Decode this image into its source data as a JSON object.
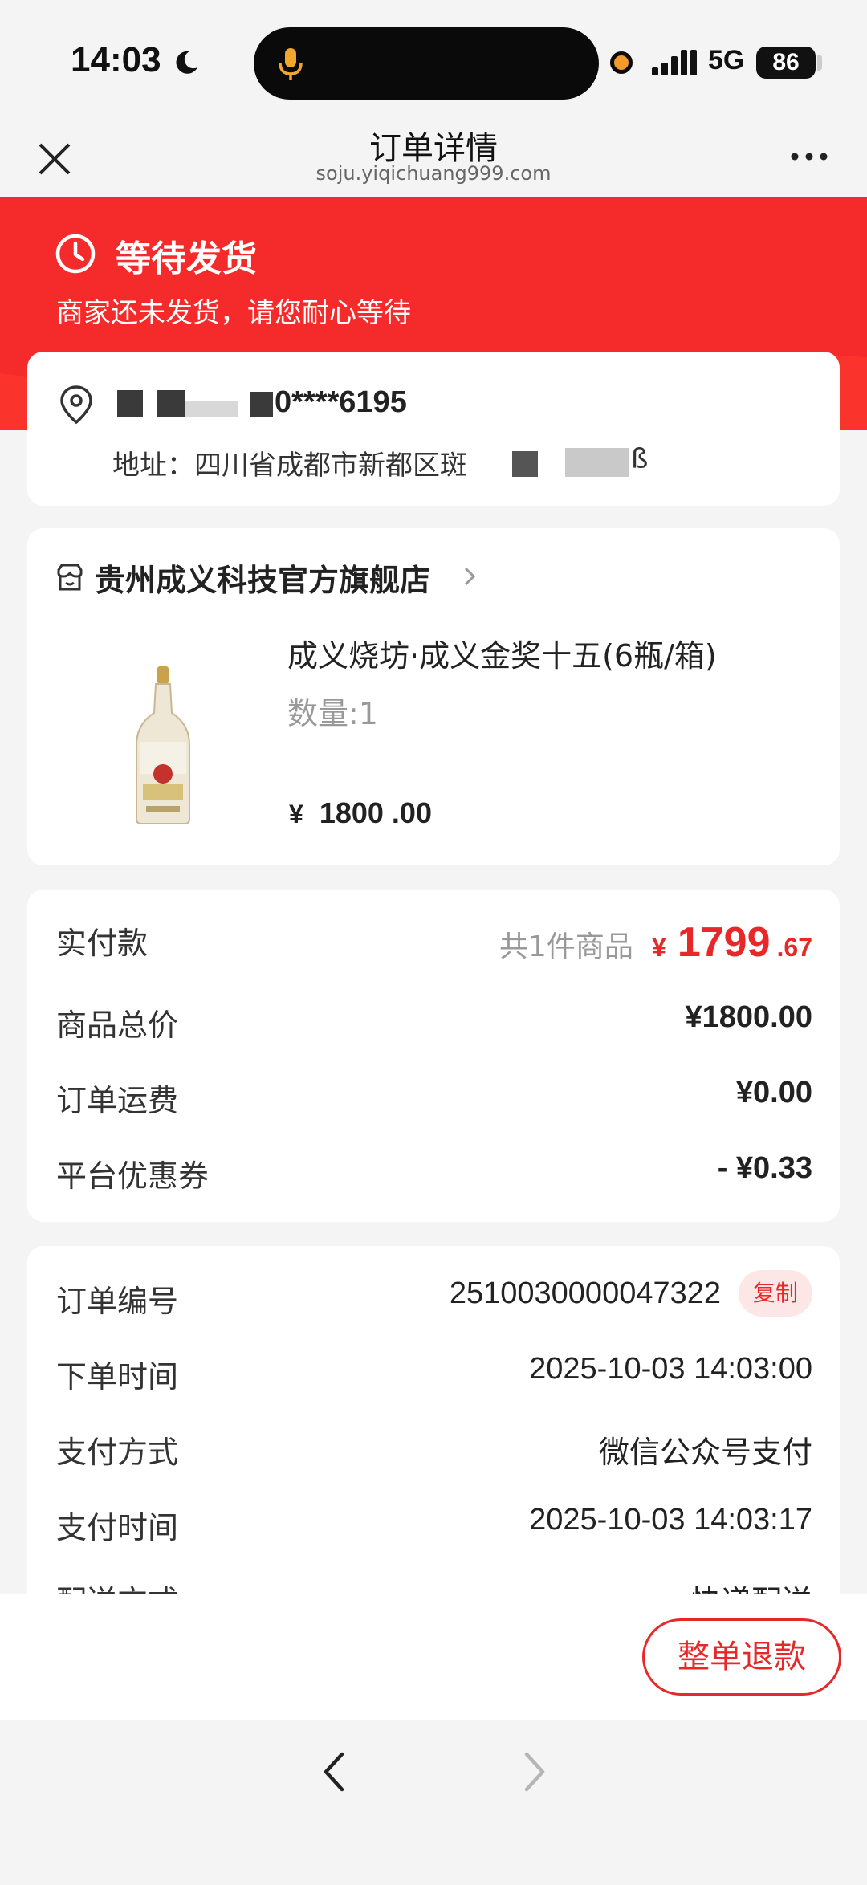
{
  "status_bar": {
    "time": "14:03",
    "network": "5G",
    "battery": "86",
    "icons": [
      "moon-icon",
      "mic-icon",
      "recording-dot-icon",
      "signal-icon"
    ]
  },
  "nav": {
    "title": "订单详情",
    "url": "soju.yiqichuang999.com",
    "close_icon": "close-icon",
    "more_icon": "more-icon"
  },
  "order_status": {
    "title": "等待发货",
    "subtitle": "商家还未发货，请您耐心等待",
    "icon": "clock-icon",
    "color": "#f52a2a"
  },
  "address": {
    "phone": "0****6195",
    "address_line": "地址：四川省成都市新都区斑",
    "address_tail": "ß",
    "icon": "location-pin-icon"
  },
  "shop": {
    "name": "贵州成义科技官方旗舰店",
    "icon": "shop-icon"
  },
  "product": {
    "name": "成义烧坊·成义金奖十五(6瓶/箱)",
    "quantity": "数量:1",
    "price_symbol": "¥",
    "price_int": "1800",
    "price_dec": ".00"
  },
  "payment": {
    "paid_label": "实付款",
    "item_count": "共1件商品",
    "paid_symbol": "¥",
    "paid_int": "1799",
    "paid_dec": ".67",
    "rows": [
      {
        "label": "商品总价",
        "value": "¥1800.00"
      },
      {
        "label": "订单运费",
        "value": "¥0.00"
      },
      {
        "label": "平台优惠券",
        "value": "- ¥0.33"
      }
    ]
  },
  "order_info": {
    "order_no_label": "订单编号",
    "order_no": "2510030000047322",
    "copy_label": "复制",
    "rows": [
      {
        "label": "下单时间",
        "value": "2025-10-03 14:03:00"
      },
      {
        "label": "支付方式",
        "value": "微信公众号支付"
      },
      {
        "label": "支付时间",
        "value": "2025-10-03 14:03:17"
      },
      {
        "label": "配送方式",
        "value": "快递配送"
      }
    ]
  },
  "actions": {
    "refund_label": "整单退款"
  },
  "browser_nav": {
    "back_icon": "back-arrow-icon",
    "forward_icon": "forward-arrow-icon"
  },
  "colors": {
    "accent": "#e82828",
    "header_red": "#f52a2a",
    "background": "#f4f4f4"
  }
}
